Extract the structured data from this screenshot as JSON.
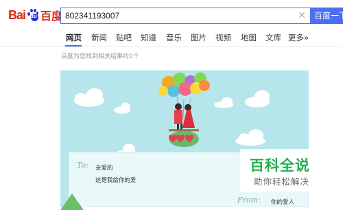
{
  "header": {
    "logo_bai": "Bai",
    "logo_du": "du",
    "logo_cn": "百度",
    "search_value": "802341193007",
    "search_button": "百度一下",
    "clear_glyph": "✕"
  },
  "tabs": [
    {
      "label": "网页",
      "active": true
    },
    {
      "label": "新闻"
    },
    {
      "label": "贴吧"
    },
    {
      "label": "知道"
    },
    {
      "label": "音乐"
    },
    {
      "label": "图片"
    },
    {
      "label": "视频"
    },
    {
      "label": "地图"
    },
    {
      "label": "文库"
    },
    {
      "label": "更多»"
    }
  ],
  "result_count": "百度为您找到相关结果约1个",
  "illustration": {
    "to_label": "To:",
    "line1": "亲爱的",
    "line2": "这是我给你的爱",
    "from_label": "From:",
    "from_text": "你的爱人",
    "balloon_colors": [
      "#f5a623",
      "#7ed957",
      "#f06a8a",
      "#5bc0de",
      "#ffd83a",
      "#b06fd8",
      "#ff8a3d"
    ]
  },
  "watermark": {
    "title": "百科全说",
    "subtitle": "助你轻松解决"
  }
}
